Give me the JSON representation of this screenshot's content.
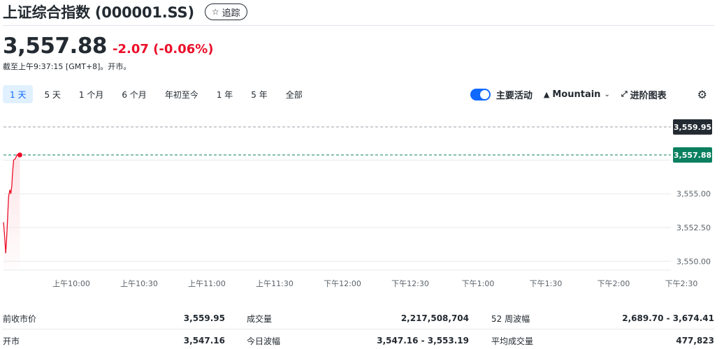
{
  "header": {
    "title": "上证综合指数 (000001.SS)",
    "follow_label": "追踪"
  },
  "quote": {
    "price": "3,557.88",
    "change": "-2.07 (-0.06%)",
    "market_time": "截至上午9:37:15 [GMT+8]。开市。"
  },
  "range_tabs": [
    "1 天",
    "5 天",
    "1 个月",
    "6 个月",
    "年初至今",
    "1 年",
    "5 年",
    "全部"
  ],
  "active_range": 0,
  "chart_tools": {
    "events_label": "主要活动",
    "events_enabled": true,
    "chart_type_label": "Mountain",
    "advanced_label": "进阶图表"
  },
  "chart_data": {
    "type": "area",
    "y_ticks": [
      "3,550.00",
      "3,552.50",
      "3,555.00"
    ],
    "ylim": [
      3549.35,
      3561.6
    ],
    "prev_close": {
      "value": 3559.95,
      "label": "3,559.95"
    },
    "last_price": {
      "value": 3557.88,
      "label": "3,557.88"
    },
    "x_ticks": [
      "上午10:00",
      "上午10:30",
      "上午11:00",
      "上午11:30",
      "下午12:00",
      "下午12:30",
      "下午1:00",
      "下午1:30",
      "下午2:00",
      "下午2:30"
    ],
    "session": [
      "09:30",
      "15:00"
    ],
    "series": [
      {
        "points": [
          [
            "09:30:00",
            3552.9
          ],
          [
            "09:30:30",
            3551.9
          ],
          [
            "09:31:00",
            3550.6
          ],
          [
            "09:31:20",
            3551.5
          ],
          [
            "09:31:45",
            3553.0
          ],
          [
            "09:32:15",
            3554.8
          ],
          [
            "09:32:50",
            3555.3
          ],
          [
            "09:33:15",
            3555.0
          ],
          [
            "09:33:40",
            3555.6
          ],
          [
            "09:34:00",
            3556.5
          ],
          [
            "09:34:30",
            3557.5
          ],
          [
            "09:35:15",
            3557.6
          ],
          [
            "09:36:00",
            3557.9
          ],
          [
            "09:37:15",
            3557.88
          ]
        ]
      }
    ],
    "colors": {
      "line": "#eb0f29",
      "fill": "#fde4e7",
      "last_tag": "#0a8060",
      "prev_tag": "#232a31"
    }
  },
  "stats": {
    "rows": [
      [
        {
          "label": "前收市价",
          "value": "3,559.95"
        },
        {
          "label": "成交量",
          "value": "2,217,508,704"
        },
        {
          "label": "52 周波幅",
          "value": "2,689.70 - 3,674.41"
        }
      ],
      [
        {
          "label": "开市",
          "value": "3,547.16"
        },
        {
          "label": "今日波幅",
          "value": "3,547.16 - 3,553.19"
        },
        {
          "label": "平均成交量",
          "value": "477,823"
        }
      ]
    ]
  }
}
